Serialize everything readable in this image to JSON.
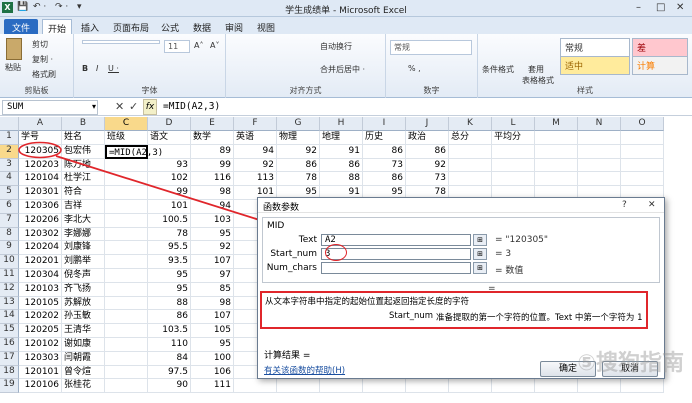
{
  "title": "学生成绩单 - Microsoft Excel",
  "window_controls": [
    "–",
    "□",
    "✕"
  ],
  "qat": [
    "X",
    "💾",
    "↶ ·",
    "↷ ·",
    "▾"
  ],
  "ribbon_tabs": [
    "文件",
    "开始",
    "插入",
    "页面布局",
    "公式",
    "数据",
    "审阅",
    "视图"
  ],
  "ribbon": {
    "paste": "粘贴",
    "cut": "剪切",
    "copy": "复制 ·",
    "format_painter": "格式刷",
    "clipboard_label": "剪贴板",
    "font_label": "字体",
    "align_label": "对齐方式",
    "number_label": "数字",
    "styles_label": "样式",
    "font_size": "11",
    "bold": "B",
    "italic": "I",
    "underline": "U ·",
    "wrap": "自动换行",
    "merge": "合并后居中 ·",
    "number_format": "常规",
    "percent": "% ,",
    "cond_format": "条件格式",
    "table_format": "套用",
    "table_format2": "表格格式",
    "style_normal": "常规",
    "style_bad": "差",
    "style_neutral": "适中",
    "style_calc": "计算"
  },
  "formula_bar": {
    "name_box": "SUM",
    "fx": "fx",
    "formula": "=MID(A2,3)"
  },
  "columns": [
    "A",
    "B",
    "C",
    "D",
    "E",
    "F",
    "G",
    "H",
    "I",
    "J",
    "K",
    "L",
    "M",
    "N",
    "O"
  ],
  "headers": [
    "学号",
    "姓名",
    "班级",
    "语文",
    "数学",
    "英语",
    "物理",
    "地理",
    "历史",
    "政治",
    "总分",
    "平均分"
  ],
  "rows": [
    [
      "120305",
      "包宏伟",
      "=MID(A2,3)",
      "",
      "89",
      "94",
      "92",
      "91",
      "86",
      "86"
    ],
    [
      "120203",
      "陈万地",
      "",
      "93",
      "99",
      "92",
      "86",
      "86",
      "73",
      "92"
    ],
    [
      "120104",
      "杜学江",
      "",
      "102",
      "116",
      "113",
      "78",
      "88",
      "86",
      "73"
    ],
    [
      "120301",
      "符合",
      "",
      "99",
      "98",
      "101",
      "95",
      "91",
      "95",
      "78"
    ],
    [
      "120306",
      "吉祥",
      "",
      "101",
      "94",
      "",
      "",
      "",
      "",
      ""
    ],
    [
      "120206",
      "李北大",
      "",
      "100.5",
      "103",
      "",
      "",
      "",
      "",
      ""
    ],
    [
      "120302",
      "李娜娜",
      "",
      "78",
      "95",
      "",
      "",
      "",
      "",
      ""
    ],
    [
      "120204",
      "刘康锋",
      "",
      "95.5",
      "92",
      "",
      "",
      "",
      "",
      ""
    ],
    [
      "120201",
      "刘鹏举",
      "",
      "93.5",
      "107",
      "",
      "",
      "",
      "",
      ""
    ],
    [
      "120304",
      "倪冬声",
      "",
      "95",
      "97",
      "",
      "",
      "",
      "",
      ""
    ],
    [
      "120103",
      "齐飞扬",
      "",
      "95",
      "85",
      "",
      "",
      "",
      "",
      ""
    ],
    [
      "120105",
      "苏解放",
      "",
      "88",
      "98",
      "",
      "",
      "",
      "",
      ""
    ],
    [
      "120202",
      "孙玉敏",
      "",
      "86",
      "107",
      "",
      "",
      "",
      "",
      ""
    ],
    [
      "120205",
      "王清华",
      "",
      "103.5",
      "105",
      "",
      "",
      "",
      "",
      ""
    ],
    [
      "120102",
      "谢如康",
      "",
      "110",
      "95",
      "",
      "",
      "",
      "",
      ""
    ],
    [
      "120303",
      "闫朝霞",
      "",
      "84",
      "100",
      "",
      "",
      "",
      "",
      ""
    ],
    [
      "120101",
      "曾令煊",
      "",
      "97.5",
      "106",
      "",
      "",
      "",
      "",
      ""
    ],
    [
      "120106",
      "张桂花",
      "",
      "90",
      "111",
      "",
      "",
      "",
      "",
      ""
    ]
  ],
  "dialog": {
    "title": "函数参数",
    "help": "?",
    "close": "✕",
    "function": "MID",
    "args": [
      {
        "label": "Text",
        "value": "A2",
        "result": "= \"120305\""
      },
      {
        "label": "Start_num",
        "value": "3",
        "result": "= 3"
      },
      {
        "label": "Num_chars",
        "value": "",
        "result": "= 数值"
      }
    ],
    "total": "=",
    "description": "从文本字符串中指定的起始位置起返回指定长度的字符",
    "arg_help_name": "Start_num",
    "arg_help_text": "准备提取的第一个字符的位置。Text 中第一个字符为 1",
    "calc_result": "计算结果 =",
    "help_link": "有关该函数的帮助(H)",
    "ok": "确定",
    "cancel": "取消"
  },
  "watermark": "⑤搜狗指南",
  "colors": {
    "accent": "#2a6bc2",
    "selected_header": "#f9d98b",
    "annotation": "#e0262b"
  }
}
